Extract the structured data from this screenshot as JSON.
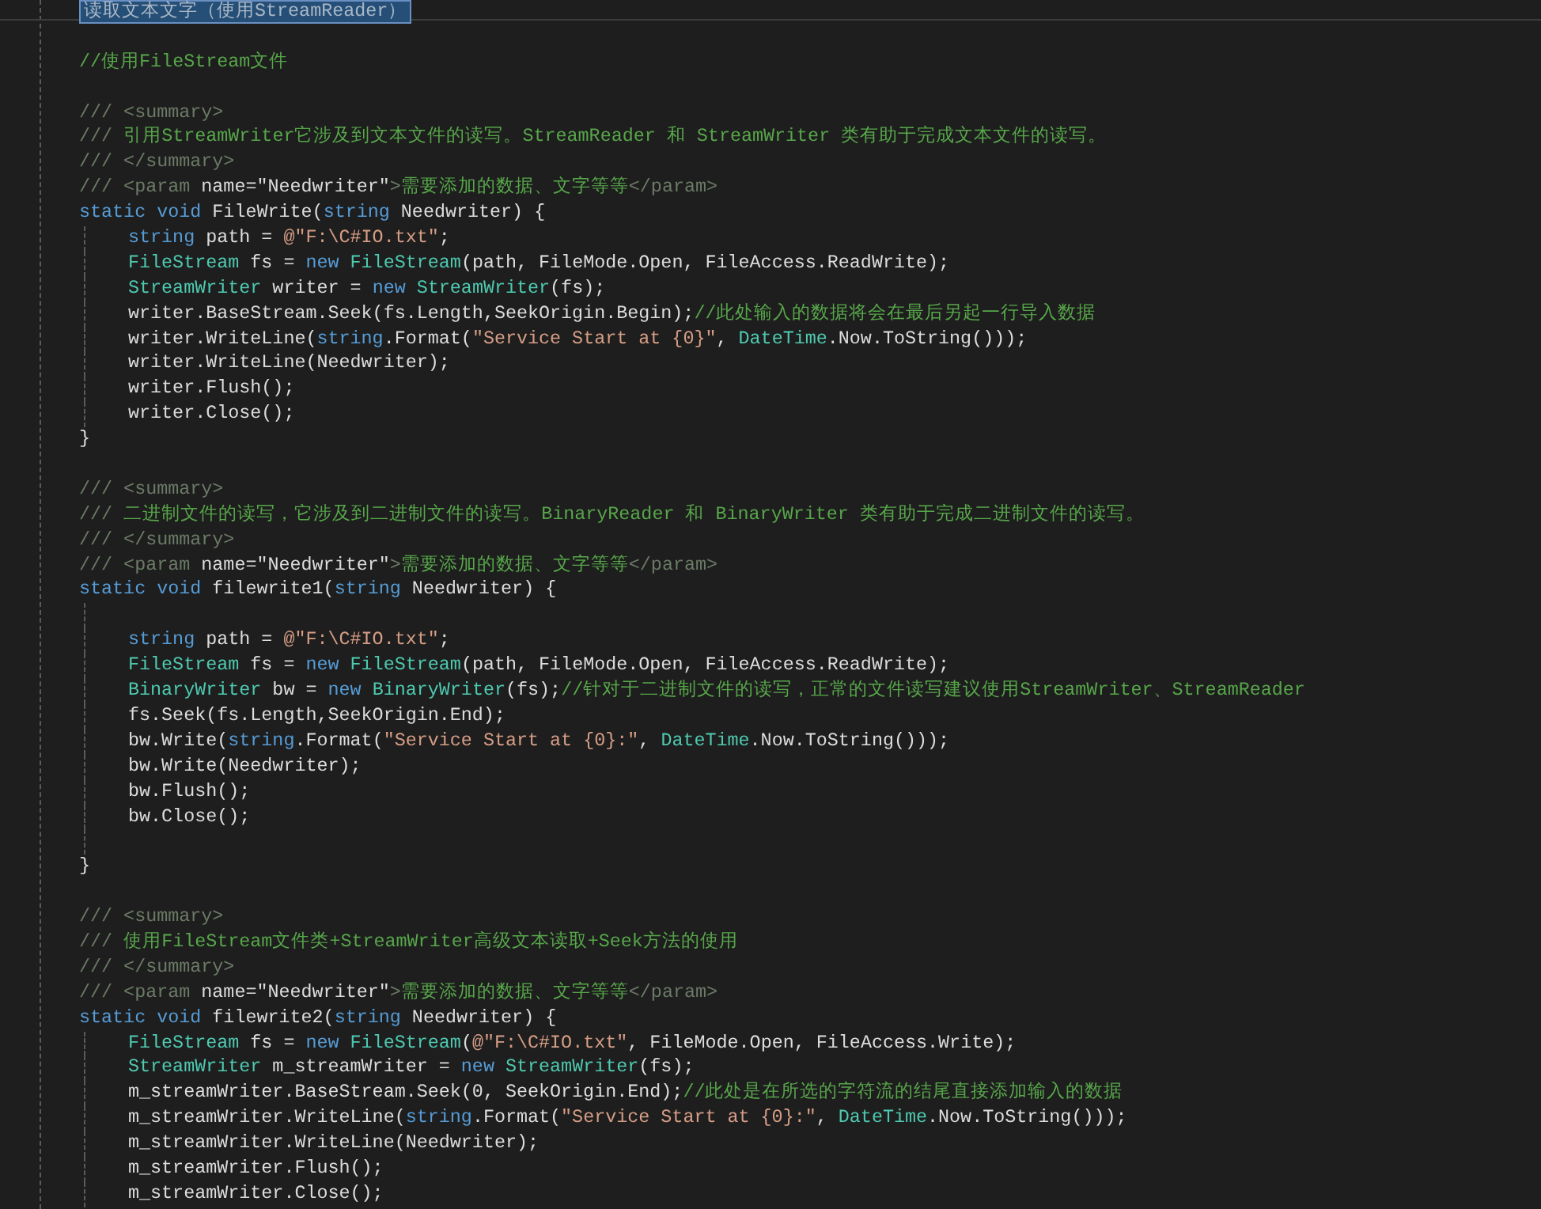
{
  "editor": {
    "lines": [
      {
        "kind": "region",
        "tokens": [
          {
            "kind": "plain",
            "text": "读取文本文字（使用StreamReader）"
          }
        ]
      },
      {
        "kind": "blank"
      },
      {
        "kind": "code",
        "tokens": [
          {
            "kind": "comment",
            "text": "//使用FileStream文件"
          }
        ]
      },
      {
        "kind": "blank"
      },
      {
        "kind": "code",
        "tokens": [
          {
            "kind": "doc",
            "text": "/// <summary>"
          }
        ]
      },
      {
        "kind": "code",
        "tokens": [
          {
            "kind": "doc",
            "text": "/// "
          },
          {
            "kind": "comment",
            "text": "引用StreamWriter它涉及到文本文件的读写。StreamReader 和 StreamWriter 类有助于完成文本文件的读写。"
          }
        ]
      },
      {
        "kind": "code",
        "tokens": [
          {
            "kind": "doc",
            "text": "/// </summary>"
          }
        ]
      },
      {
        "kind": "code",
        "tokens": [
          {
            "kind": "doc",
            "text": "/// <param "
          },
          {
            "kind": "plain",
            "text": "name=\"Needwriter\""
          },
          {
            "kind": "doc",
            "text": ">"
          },
          {
            "kind": "comment",
            "text": "需要添加的数据、文字等等"
          },
          {
            "kind": "doc",
            "text": "</param>"
          }
        ]
      },
      {
        "kind": "code",
        "tokens": [
          {
            "kind": "keyword",
            "text": "static void"
          },
          {
            "kind": "plain",
            "text": " FileWrite("
          },
          {
            "kind": "keyword",
            "text": "string"
          },
          {
            "kind": "plain",
            "text": " Needwriter) {"
          }
        ]
      },
      {
        "kind": "body",
        "tokens": [
          {
            "kind": "keyword",
            "text": "string"
          },
          {
            "kind": "plain",
            "text": " path = "
          },
          {
            "kind": "string",
            "text": "@\"F:\\C#IO.txt\""
          },
          {
            "kind": "plain",
            "text": ";"
          }
        ]
      },
      {
        "kind": "body",
        "tokens": [
          {
            "kind": "type",
            "text": "FileStream"
          },
          {
            "kind": "plain",
            "text": " fs = "
          },
          {
            "kind": "keyword",
            "text": "new "
          },
          {
            "kind": "type",
            "text": "FileStream"
          },
          {
            "kind": "plain",
            "text": "(path, FileMode.Open, FileAccess.ReadWrite);"
          }
        ]
      },
      {
        "kind": "body",
        "tokens": [
          {
            "kind": "type",
            "text": "StreamWriter"
          },
          {
            "kind": "plain",
            "text": " writer = "
          },
          {
            "kind": "keyword",
            "text": "new "
          },
          {
            "kind": "type",
            "text": "StreamWriter"
          },
          {
            "kind": "plain",
            "text": "(fs);"
          }
        ]
      },
      {
        "kind": "body",
        "tokens": [
          {
            "kind": "plain",
            "text": "writer.BaseStream.Seek(fs.Length,SeekOrigin.Begin);"
          },
          {
            "kind": "comment",
            "text": "//此处输入的数据将会在最后另起一行导入数据"
          }
        ]
      },
      {
        "kind": "body",
        "tokens": [
          {
            "kind": "plain",
            "text": "writer.WriteLine("
          },
          {
            "kind": "keyword",
            "text": "string"
          },
          {
            "kind": "plain",
            "text": ".Format("
          },
          {
            "kind": "string",
            "text": "\"Service Start at {0}\""
          },
          {
            "kind": "plain",
            "text": ", "
          },
          {
            "kind": "type",
            "text": "DateTime"
          },
          {
            "kind": "plain",
            "text": ".Now.ToString()));"
          }
        ]
      },
      {
        "kind": "body",
        "tokens": [
          {
            "kind": "plain",
            "text": "writer.WriteLine(Needwriter);"
          }
        ]
      },
      {
        "kind": "body",
        "tokens": [
          {
            "kind": "plain",
            "text": "writer.Flush();"
          }
        ]
      },
      {
        "kind": "body",
        "tokens": [
          {
            "kind": "plain",
            "text": "writer.Close();"
          }
        ]
      },
      {
        "kind": "code",
        "tokens": [
          {
            "kind": "plain",
            "text": "}"
          }
        ]
      },
      {
        "kind": "blank"
      },
      {
        "kind": "code",
        "tokens": [
          {
            "kind": "doc",
            "text": "/// <summary>"
          }
        ]
      },
      {
        "kind": "code",
        "tokens": [
          {
            "kind": "doc",
            "text": "/// "
          },
          {
            "kind": "comment",
            "text": "二进制文件的读写，它涉及到二进制文件的读写。BinaryReader 和 BinaryWriter 类有助于完成二进制文件的读写。"
          }
        ]
      },
      {
        "kind": "code",
        "tokens": [
          {
            "kind": "doc",
            "text": "/// </summary>"
          }
        ]
      },
      {
        "kind": "code",
        "tokens": [
          {
            "kind": "doc",
            "text": "/// <param "
          },
          {
            "kind": "plain",
            "text": "name=\"Needwriter\""
          },
          {
            "kind": "doc",
            "text": ">"
          },
          {
            "kind": "comment",
            "text": "需要添加的数据、文字等等"
          },
          {
            "kind": "doc",
            "text": "</param>"
          }
        ]
      },
      {
        "kind": "code",
        "tokens": [
          {
            "kind": "keyword",
            "text": "static void"
          },
          {
            "kind": "plain",
            "text": " filewrite1("
          },
          {
            "kind": "keyword",
            "text": "string"
          },
          {
            "kind": "plain",
            "text": " Needwriter) {"
          }
        ]
      },
      {
        "kind": "body-blank"
      },
      {
        "kind": "body",
        "tokens": [
          {
            "kind": "keyword",
            "text": "string"
          },
          {
            "kind": "plain",
            "text": " path = "
          },
          {
            "kind": "string",
            "text": "@\"F:\\C#IO.txt\""
          },
          {
            "kind": "plain",
            "text": ";"
          }
        ]
      },
      {
        "kind": "body",
        "tokens": [
          {
            "kind": "type",
            "text": "FileStream"
          },
          {
            "kind": "plain",
            "text": " fs = "
          },
          {
            "kind": "keyword",
            "text": "new "
          },
          {
            "kind": "type",
            "text": "FileStream"
          },
          {
            "kind": "plain",
            "text": "(path, FileMode.Open, FileAccess.ReadWrite);"
          }
        ]
      },
      {
        "kind": "body",
        "tokens": [
          {
            "kind": "type",
            "text": "BinaryWriter"
          },
          {
            "kind": "plain",
            "text": " bw = "
          },
          {
            "kind": "keyword",
            "text": "new "
          },
          {
            "kind": "type",
            "text": "BinaryWriter"
          },
          {
            "kind": "plain",
            "text": "(fs);"
          },
          {
            "kind": "comment",
            "text": "//针对于二进制文件的读写，正常的文件读写建议使用StreamWriter、StreamReader"
          }
        ]
      },
      {
        "kind": "body",
        "tokens": [
          {
            "kind": "plain",
            "text": "fs.Seek(fs.Length,SeekOrigin.End);"
          }
        ]
      },
      {
        "kind": "body",
        "tokens": [
          {
            "kind": "plain",
            "text": "bw.Write("
          },
          {
            "kind": "keyword",
            "text": "string"
          },
          {
            "kind": "plain",
            "text": ".Format("
          },
          {
            "kind": "string",
            "text": "\"Service Start at {0}:\""
          },
          {
            "kind": "plain",
            "text": ", "
          },
          {
            "kind": "type",
            "text": "DateTime"
          },
          {
            "kind": "plain",
            "text": ".Now.ToString()));"
          }
        ]
      },
      {
        "kind": "body",
        "tokens": [
          {
            "kind": "plain",
            "text": "bw.Write(Needwriter);"
          }
        ]
      },
      {
        "kind": "body",
        "tokens": [
          {
            "kind": "plain",
            "text": "bw.Flush();"
          }
        ]
      },
      {
        "kind": "body",
        "tokens": [
          {
            "kind": "plain",
            "text": "bw.Close();"
          }
        ]
      },
      {
        "kind": "body-blank"
      },
      {
        "kind": "code",
        "tokens": [
          {
            "kind": "plain",
            "text": "}"
          }
        ]
      },
      {
        "kind": "blank"
      },
      {
        "kind": "code",
        "tokens": [
          {
            "kind": "doc",
            "text": "/// <summary>"
          }
        ]
      },
      {
        "kind": "code",
        "tokens": [
          {
            "kind": "doc",
            "text": "/// "
          },
          {
            "kind": "comment",
            "text": "使用FileStream文件类+StreamWriter高级文本读取+Seek方法的使用"
          }
        ]
      },
      {
        "kind": "code",
        "tokens": [
          {
            "kind": "doc",
            "text": "/// </summary>"
          }
        ]
      },
      {
        "kind": "code",
        "tokens": [
          {
            "kind": "doc",
            "text": "/// <param "
          },
          {
            "kind": "plain",
            "text": "name=\"Needwriter\""
          },
          {
            "kind": "doc",
            "text": ">"
          },
          {
            "kind": "comment",
            "text": "需要添加的数据、文字等等"
          },
          {
            "kind": "doc",
            "text": "</param>"
          }
        ]
      },
      {
        "kind": "code",
        "tokens": [
          {
            "kind": "keyword",
            "text": "static void"
          },
          {
            "kind": "plain",
            "text": " filewrite2("
          },
          {
            "kind": "keyword",
            "text": "string"
          },
          {
            "kind": "plain",
            "text": " Needwriter) {"
          }
        ]
      },
      {
        "kind": "body",
        "tokens": [
          {
            "kind": "type",
            "text": "FileStream"
          },
          {
            "kind": "plain",
            "text": " fs = "
          },
          {
            "kind": "keyword",
            "text": "new "
          },
          {
            "kind": "type",
            "text": "FileStream"
          },
          {
            "kind": "plain",
            "text": "("
          },
          {
            "kind": "string",
            "text": "@\"F:\\C#IO.txt\""
          },
          {
            "kind": "plain",
            "text": ", FileMode.Open, FileAccess.Write);"
          }
        ]
      },
      {
        "kind": "body",
        "tokens": [
          {
            "kind": "type",
            "text": "StreamWriter"
          },
          {
            "kind": "plain",
            "text": " m_streamWriter = "
          },
          {
            "kind": "keyword",
            "text": "new "
          },
          {
            "kind": "type",
            "text": "StreamWriter"
          },
          {
            "kind": "plain",
            "text": "(fs);"
          }
        ]
      },
      {
        "kind": "body",
        "tokens": [
          {
            "kind": "plain",
            "text": "m_streamWriter.BaseStream.Seek(0, SeekOrigin.End);"
          },
          {
            "kind": "comment",
            "text": "//此处是在所选的字符流的结尾直接添加输入的数据"
          }
        ]
      },
      {
        "kind": "body",
        "tokens": [
          {
            "kind": "plain",
            "text": "m_streamWriter.WriteLine("
          },
          {
            "kind": "keyword",
            "text": "string"
          },
          {
            "kind": "plain",
            "text": ".Format("
          },
          {
            "kind": "string",
            "text": "\"Service Start at {0}:\""
          },
          {
            "kind": "plain",
            "text": ", "
          },
          {
            "kind": "type",
            "text": "DateTime"
          },
          {
            "kind": "plain",
            "text": ".Now.ToString()));"
          }
        ]
      },
      {
        "kind": "body",
        "tokens": [
          {
            "kind": "plain",
            "text": "m_streamWriter.WriteLine(Needwriter);"
          }
        ]
      },
      {
        "kind": "body",
        "tokens": [
          {
            "kind": "plain",
            "text": "m_streamWriter.Flush();"
          }
        ]
      },
      {
        "kind": "body",
        "tokens": [
          {
            "kind": "plain",
            "text": "m_streamWriter.Close();"
          }
        ]
      }
    ]
  }
}
